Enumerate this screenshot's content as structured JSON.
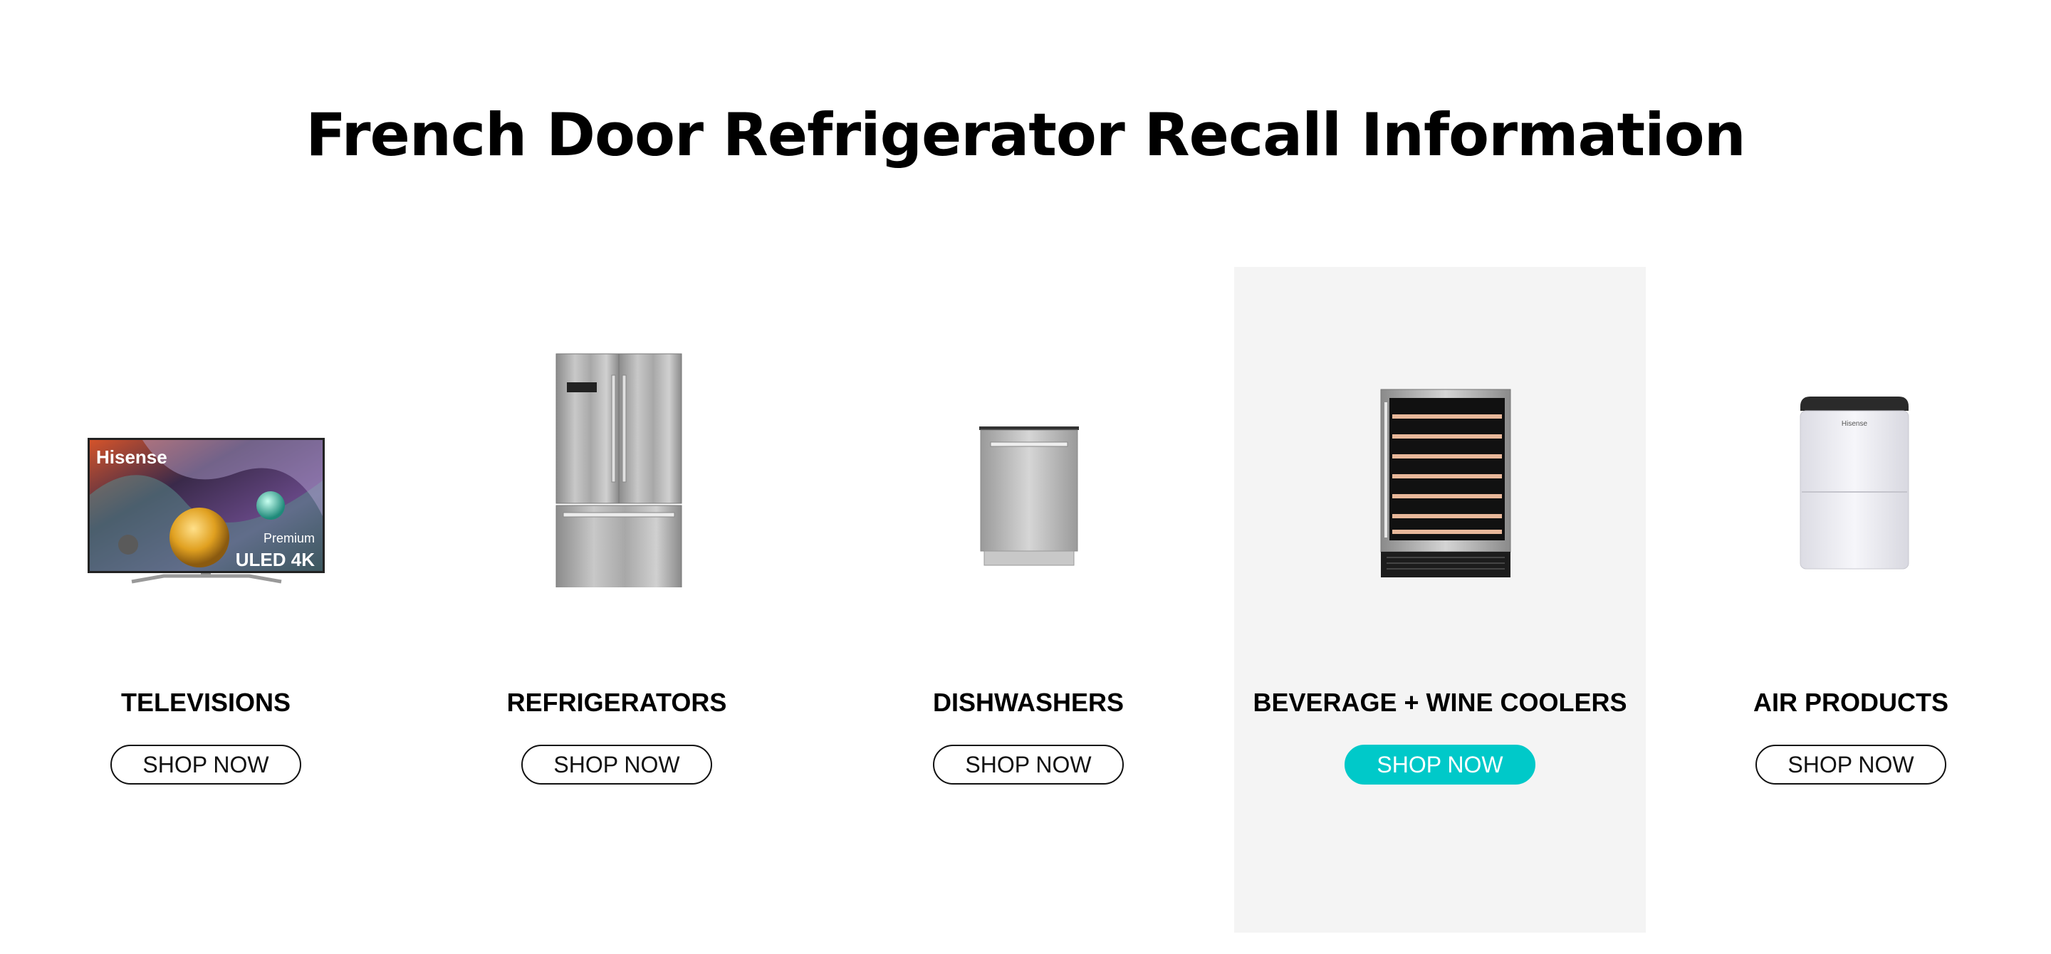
{
  "page": {
    "title": "French Door Refrigerator Recall Information"
  },
  "categories": [
    {
      "title": "TELEVISIONS",
      "button": "SHOP NOW",
      "image": "tv-icon",
      "tv_screen": {
        "brand": "Hisense",
        "line1": "Premium",
        "line2": "ULED 4K"
      }
    },
    {
      "title": "REFRIGERATORS",
      "button": "SHOP NOW",
      "image": "refrigerator-icon"
    },
    {
      "title": "DISHWASHERS",
      "button": "SHOP NOW",
      "image": "dishwasher-icon"
    },
    {
      "title": "BEVERAGE + WINE COOLERS",
      "button": "SHOP NOW",
      "image": "wine-cooler-icon"
    },
    {
      "title": "AIR PRODUCTS",
      "button": "SHOP NOW",
      "image": "dehumidifier-icon",
      "product_brand": "Hisense"
    }
  ],
  "colors": {
    "accent": "#00c9c9",
    "active_card_bg": "#f4f4f4",
    "text": "#000000"
  }
}
